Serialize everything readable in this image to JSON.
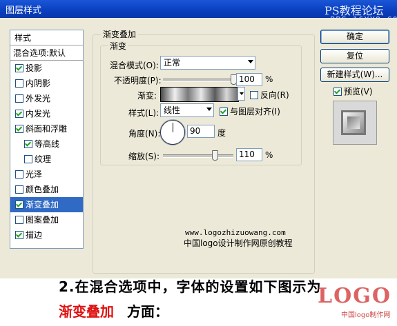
{
  "window": {
    "title": "图层样式",
    "watermark_top": "PS教程论坛",
    "watermark_url": "BBS.16XX8.COM"
  },
  "style_list": {
    "header": "样式",
    "blend_options": "混合选项:默认",
    "items": [
      {
        "label": "投影",
        "checked": true
      },
      {
        "label": "内阴影",
        "checked": false
      },
      {
        "label": "外发光",
        "checked": false
      },
      {
        "label": "内发光",
        "checked": true
      },
      {
        "label": "斜面和浮雕",
        "checked": true
      },
      {
        "label": "等高线",
        "checked": true
      },
      {
        "label": "纹理",
        "checked": false
      },
      {
        "label": "光泽",
        "checked": false
      },
      {
        "label": "颜色叠加",
        "checked": false
      },
      {
        "label": "渐变叠加",
        "checked": true,
        "selected": true
      },
      {
        "label": "图案叠加",
        "checked": false
      },
      {
        "label": "描边",
        "checked": true
      }
    ]
  },
  "panel": {
    "group_title": "渐变叠加",
    "sub_group_title": "渐变",
    "blend_mode_label": "混合模式(O):",
    "blend_mode_value": "正常",
    "opacity_label": "不透明度(P):",
    "opacity_value": "100",
    "opacity_unit": "%",
    "opacity_level": 1.0,
    "gradient_label": "渐变:",
    "reverse_label": "反向(R)",
    "reverse_checked": false,
    "style_label": "样式(L):",
    "style_value": "线性",
    "align_label": "与图层对齐(I)",
    "align_checked": true,
    "angle_label": "角度(N):",
    "angle_value": "90",
    "angle_unit": "度",
    "scale_label": "缩放(S):",
    "scale_value": "110",
    "scale_unit": "%",
    "scale_level": 0.733
  },
  "buttons": {
    "ok": "确定",
    "reset": "复位",
    "new_style": "新建样式(W)...",
    "preview_label": "预览(V)",
    "preview_checked": true
  },
  "overlay": {
    "site_url": "www.logozhizuowang.com",
    "site_desc": "中国logo设计制作网原创教程",
    "caption_line1": "2.在混合选项中，字体的设置如下图示为",
    "caption_line2_red": "渐变叠加",
    "caption_line2_rest": "方面：",
    "logo_mark": "LOGO",
    "logo_sub": "中国logo制作网"
  }
}
